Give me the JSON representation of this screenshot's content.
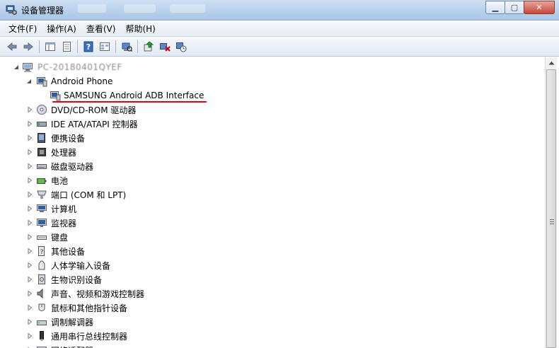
{
  "window": {
    "title": "设备管理器",
    "buttons": {
      "minimize": "▁",
      "maximize": "▢",
      "close": "✕"
    }
  },
  "menu": [
    "文件(F)",
    "操作(A)",
    "查看(V)",
    "帮助(H)"
  ],
  "toolbar": {
    "icons": [
      "back-icon",
      "forward-icon",
      "show-hide-console-tree-icon",
      "properties-icon",
      "help-icon",
      "view-icon",
      "scan-hardware-icon",
      "update-driver-icon",
      "uninstall-icon",
      "disable-icon"
    ]
  },
  "tree": {
    "root": "PC-20180401QYEF",
    "items": [
      {
        "label": "Android Phone",
        "expanded": true,
        "icon": "phone-icon",
        "children": [
          {
            "label": "SAMSUNG Android ADB Interface",
            "icon": "adb-device-icon"
          }
        ]
      },
      {
        "label": "DVD/CD-ROM 驱动器",
        "icon": "dvd-icon"
      },
      {
        "label": "IDE ATA/ATAPI 控制器",
        "icon": "ide-icon"
      },
      {
        "label": "便携设备",
        "icon": "portable-device-icon"
      },
      {
        "label": "处理器",
        "icon": "processor-icon"
      },
      {
        "label": "磁盘驱动器",
        "icon": "disk-icon"
      },
      {
        "label": "电池",
        "icon": "battery-icon"
      },
      {
        "label": "端口 (COM 和 LPT)",
        "icon": "port-icon"
      },
      {
        "label": "计算机",
        "icon": "computer-icon"
      },
      {
        "label": "监视器",
        "icon": "monitor-icon"
      },
      {
        "label": "键盘",
        "icon": "keyboard-icon"
      },
      {
        "label": "其他设备",
        "icon": "other-device-icon"
      },
      {
        "label": "人体学输入设备",
        "icon": "hid-icon"
      },
      {
        "label": "生物识别设备",
        "icon": "biometric-icon"
      },
      {
        "label": "声音、视频和游戏控制器",
        "icon": "sound-icon"
      },
      {
        "label": "鼠标和其他指针设备",
        "icon": "mouse-icon"
      },
      {
        "label": "调制解调器",
        "icon": "modem-icon"
      },
      {
        "label": "通用串行总线控制器",
        "icon": "usb-icon"
      },
      {
        "label": "网络适配器",
        "icon": "network-icon"
      }
    ]
  },
  "colors": {
    "highlight_underline": "#e0001a",
    "titlebar": "#bcd3ec"
  }
}
